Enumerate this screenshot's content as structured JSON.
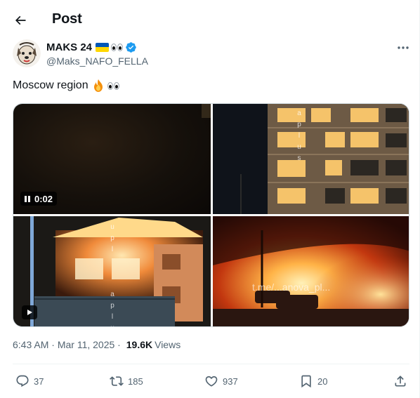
{
  "header": {
    "title": "Post",
    "back_icon": "arrow-left-icon"
  },
  "author": {
    "name": "MAKS 24",
    "handle": "@Maks_NAFO_FELLA",
    "badges": [
      "ukraine-flag-icon",
      "eyes-icon",
      "verified-badge-icon"
    ],
    "verified_color": "#1d9bf0"
  },
  "tweet": {
    "text": "Moscow region",
    "emojis": [
      "fire-icon",
      "eyes-icon"
    ]
  },
  "media": {
    "video_duration": "0:02",
    "watermark": "t.me/...anova_pl..."
  },
  "meta": {
    "time": "6:43 AM",
    "separator1": " · ",
    "date": "Mar 11, 2025",
    "separator2": " · ",
    "views_count": "19.6K",
    "views_label": "Views"
  },
  "actions": {
    "replies": "37",
    "reposts": "185",
    "likes": "937",
    "bookmarks": "20"
  },
  "colors": {
    "text": "#0f1419",
    "secondary": "#536471",
    "border": "#cfd9de"
  }
}
